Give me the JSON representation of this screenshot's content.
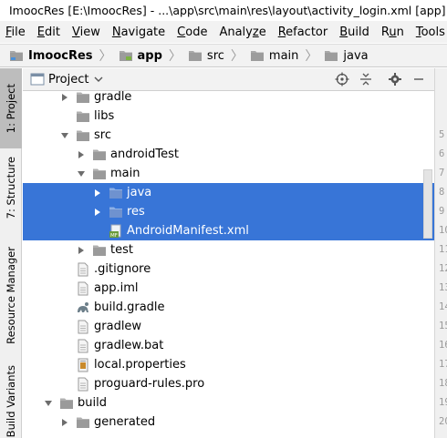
{
  "titlebar": {
    "title": "ImoocRes [E:\\ImoocRes] - ...\\app\\src\\main\\res\\layout\\activity_login.xml [app] - Ar"
  },
  "menubar": {
    "items": [
      {
        "mn": "F",
        "rest": "ile"
      },
      {
        "mn": "E",
        "rest": "dit"
      },
      {
        "mn": "V",
        "rest": "iew"
      },
      {
        "mn": "N",
        "rest": "avigate"
      },
      {
        "mn": "C",
        "rest": "ode"
      },
      {
        "mn": "",
        "pre": "Analy",
        "mn2": "z",
        "rest": "e"
      },
      {
        "mn": "R",
        "rest": "efactor"
      },
      {
        "mn": "B",
        "rest": "uild"
      },
      {
        "pre": "R",
        "mn2": "u",
        "rest": "n"
      },
      {
        "mn": "T",
        "rest": "ools"
      },
      {
        "pre": "VC",
        "mn2": "S",
        "rest": ""
      }
    ]
  },
  "breadcrumb": {
    "items": [
      "ImoocRes",
      "app",
      "src",
      "main",
      "java"
    ]
  },
  "toolstrip": {
    "project_tab": "1: Project",
    "structure_tab": "7: Structure",
    "resource_tab": "Resource Manager",
    "variants_tab": "Build Variants"
  },
  "panel": {
    "title": "Project"
  },
  "tree": {
    "rows": [
      {
        "label": "gradle",
        "indent": 2,
        "arrow": "right",
        "icon": "folder",
        "selected": false
      },
      {
        "label": "libs",
        "indent": 2,
        "arrow": "none",
        "icon": "folder",
        "selected": false
      },
      {
        "label": "src",
        "indent": 2,
        "arrow": "down",
        "icon": "folder",
        "selected": false
      },
      {
        "label": "androidTest",
        "indent": 3,
        "arrow": "right",
        "icon": "folder",
        "selected": false
      },
      {
        "label": "main",
        "indent": 3,
        "arrow": "down",
        "icon": "folder",
        "selected": false
      },
      {
        "label": "java",
        "indent": 4,
        "arrow": "right",
        "icon": "folder-blue",
        "selected": true
      },
      {
        "label": "res",
        "indent": 4,
        "arrow": "right",
        "icon": "folder-res",
        "selected": true
      },
      {
        "label": "AndroidManifest.xml",
        "indent": 4,
        "arrow": "none",
        "icon": "manifest",
        "selected": true
      },
      {
        "label": "test",
        "indent": 3,
        "arrow": "right",
        "icon": "folder",
        "selected": false
      },
      {
        "label": ".gitignore",
        "indent": 2,
        "arrow": "none",
        "icon": "file",
        "selected": false
      },
      {
        "label": "app.iml",
        "indent": 2,
        "arrow": "none",
        "icon": "file",
        "selected": false
      },
      {
        "label": "build.gradle",
        "indent": 2,
        "arrow": "none",
        "icon": "gradle",
        "selected": false
      },
      {
        "label": "gradlew",
        "indent": 2,
        "arrow": "none",
        "icon": "file",
        "selected": false
      },
      {
        "label": "gradlew.bat",
        "indent": 2,
        "arrow": "none",
        "icon": "file",
        "selected": false
      },
      {
        "label": "local.properties",
        "indent": 2,
        "arrow": "none",
        "icon": "props",
        "selected": false
      },
      {
        "label": "proguard-rules.pro",
        "indent": 2,
        "arrow": "none",
        "icon": "file",
        "selected": false
      },
      {
        "label": "build",
        "indent": 1,
        "arrow": "down",
        "icon": "folder",
        "selected": false
      },
      {
        "label": "generated",
        "indent": 2,
        "arrow": "right",
        "icon": "folder",
        "selected": false
      }
    ]
  },
  "gutter": {
    "line_numbers": [
      "",
      "",
      "",
      "5",
      "6",
      "7",
      "8",
      "9",
      "10",
      "11",
      "12",
      "13",
      "14",
      "15",
      "16",
      "17",
      "18",
      "19",
      "20"
    ]
  }
}
